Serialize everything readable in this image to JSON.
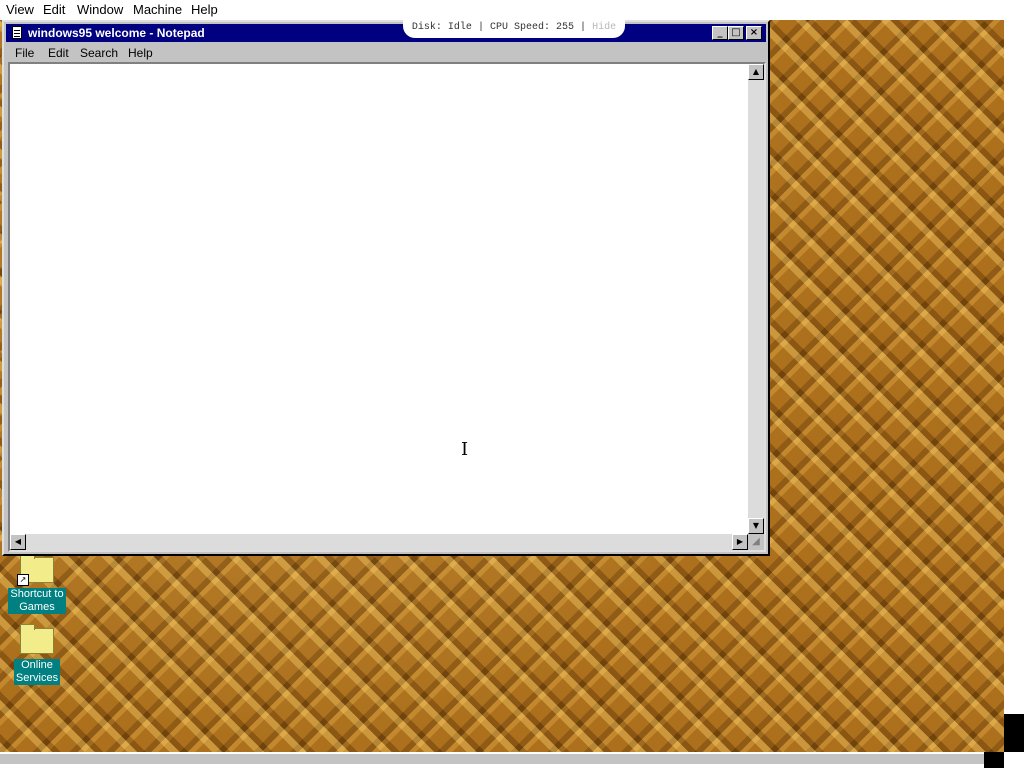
{
  "host_menu": {
    "items": [
      "View",
      "Edit",
      "Window",
      "Machine",
      "Help"
    ]
  },
  "status_pill": {
    "disk_label": "Disk:",
    "disk_value": "Idle",
    "separator": "|",
    "cpu_label": "CPU Speed:",
    "cpu_value": "255",
    "hide_label": "Hide"
  },
  "window": {
    "title": "windows95 welcome - Notepad",
    "buttons": {
      "minimize": "_",
      "maximize": "□",
      "close": "×"
    },
    "menu": [
      "File",
      "Edit",
      "Search",
      "Help"
    ],
    "text_content": ""
  },
  "desktop": {
    "icons": [
      {
        "label_line1": "Shortcut to",
        "label_line2": "Games",
        "icon": "folder-shortcut-icon"
      },
      {
        "label_line1": "Online",
        "label_line2": "Services",
        "icon": "folder-icon"
      }
    ]
  },
  "colors": {
    "titlebar": "#000080",
    "chrome": "#c3c3c3",
    "icon_label_bg": "#008080",
    "wallpaper": "#a86c1a"
  }
}
